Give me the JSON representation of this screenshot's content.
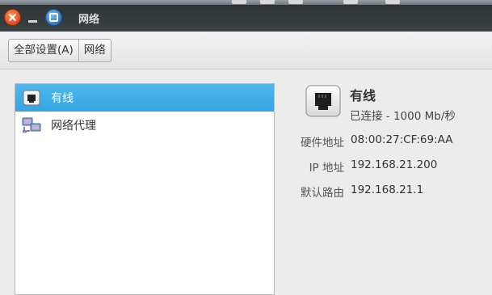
{
  "window": {
    "title": "网络"
  },
  "toolbar": {
    "breadcrumbs": [
      "全部设置(A)",
      "网络"
    ]
  },
  "sidebar": {
    "items": [
      {
        "label": "有线",
        "icon": "ethernet-icon",
        "selected": true
      },
      {
        "label": "网络代理",
        "icon": "network-proxy-icon",
        "selected": false
      }
    ]
  },
  "details": {
    "name": "有线",
    "status": "已连接 - 1000 Mb/秒",
    "properties": [
      {
        "label": "硬件地址",
        "value": "08:00:27:CF:69:AA"
      },
      {
        "label": "IP 地址",
        "value": "192.168.21.200"
      },
      {
        "label": "默认路由",
        "value": "192.168.21.1"
      }
    ]
  },
  "colors": {
    "selection": "#3daee9",
    "titlebar": "#2e3436",
    "close": "#e04e1c",
    "maximize": "#2a78c8"
  }
}
